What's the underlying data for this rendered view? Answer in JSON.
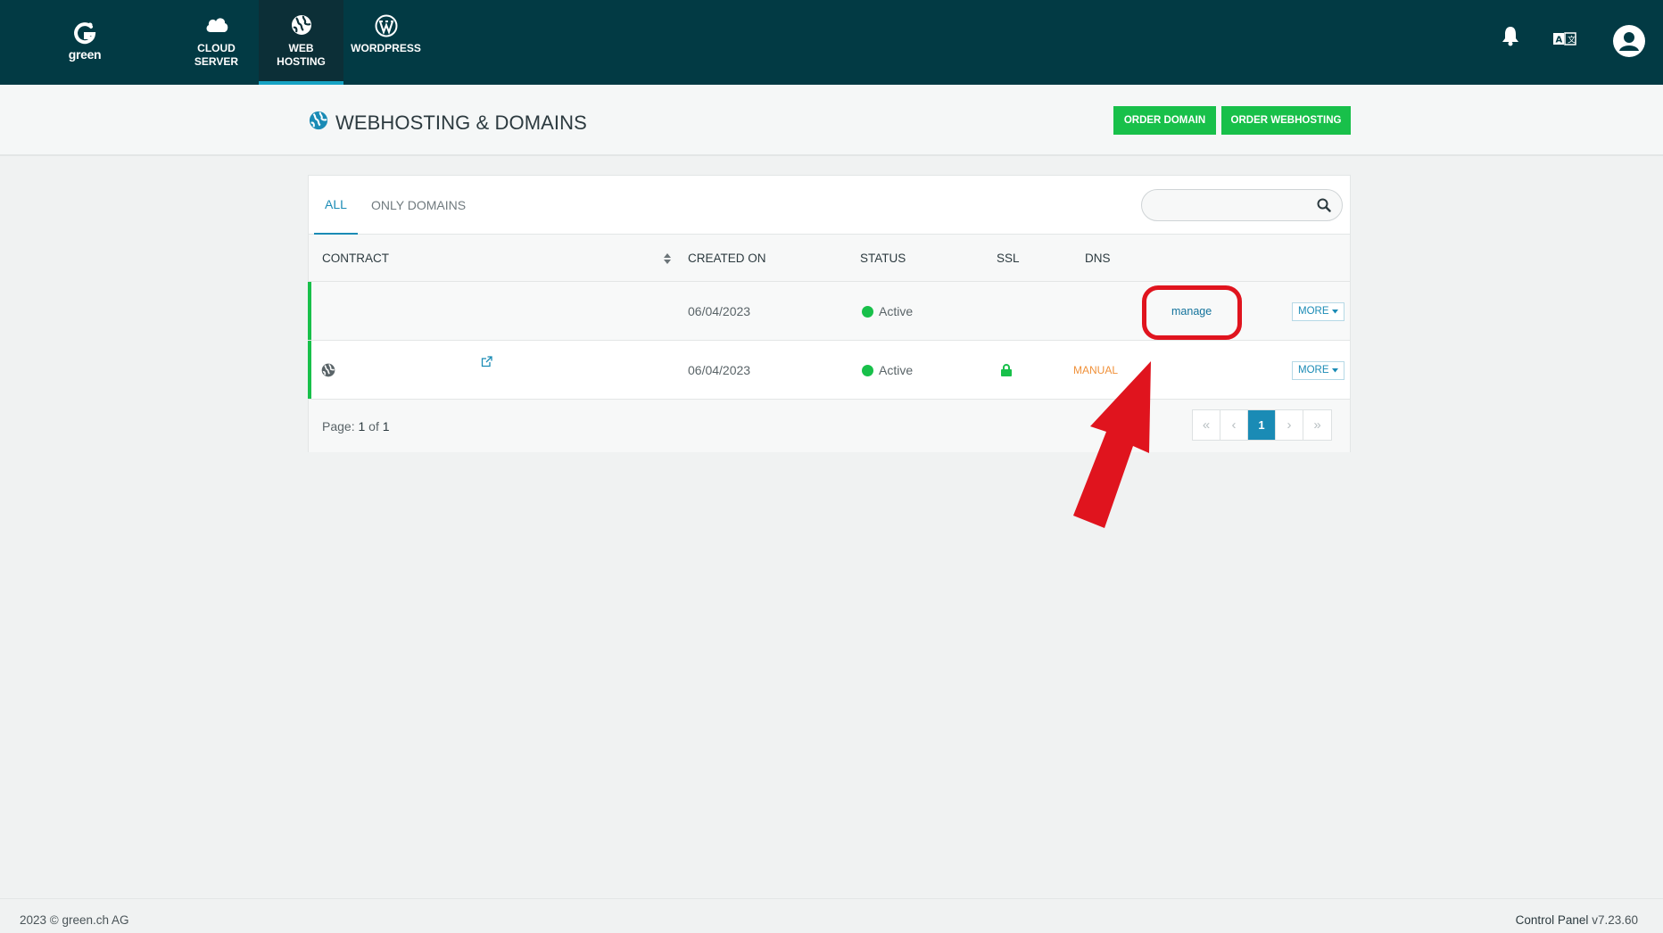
{
  "app": {
    "logo_text": "green"
  },
  "nav": {
    "items": [
      {
        "label": "CLOUD SERVER",
        "line1": "CLOUD",
        "line2": "SERVER",
        "icon": "cloud-icon"
      },
      {
        "label": "WEB HOSTING",
        "line1": "WEB",
        "line2": "HOSTING",
        "icon": "globe-icon",
        "active": true
      },
      {
        "label": "WORDPRESS",
        "line1": "WORDPRESS",
        "line2": "",
        "icon": "wordpress-icon"
      }
    ],
    "right_icons": [
      "bell-icon",
      "language-icon",
      "user-avatar-icon"
    ]
  },
  "header": {
    "title": "WEBHOSTING & DOMAINS",
    "order_domain": "ORDER DOMAIN",
    "order_webhosting": "ORDER WEBHOSTING"
  },
  "tabs": [
    {
      "label": "ALL",
      "active": true
    },
    {
      "label": "ONLY DOMAINS",
      "active": false
    }
  ],
  "search": {
    "placeholder": "",
    "value": ""
  },
  "table": {
    "columns": [
      "CONTRACT",
      "CREATED ON",
      "STATUS",
      "SSL",
      "DNS"
    ],
    "rows": [
      {
        "contract": "",
        "created_on": "06/04/2023",
        "status": "Active",
        "ssl": "",
        "dns": "",
        "action": "manage",
        "more": "MORE"
      },
      {
        "contract": "",
        "created_on": "06/04/2023",
        "status": "Active",
        "ssl": "lock-icon",
        "dns": "MANUAL",
        "action": "",
        "more": "MORE"
      }
    ]
  },
  "pagination": {
    "page_label": "Page:",
    "current": "1",
    "of_label": "of",
    "total": "1"
  },
  "colors": {
    "topbar": "#023a44",
    "accent": "#1a8bb5",
    "green": "#18c04a",
    "annotation_red": "#e0141e",
    "dns_manual": "#f0913a"
  },
  "footer": {
    "copyright": "2023 © green.ch AG",
    "app_name": "Control Panel",
    "version": "v7.23.60"
  }
}
